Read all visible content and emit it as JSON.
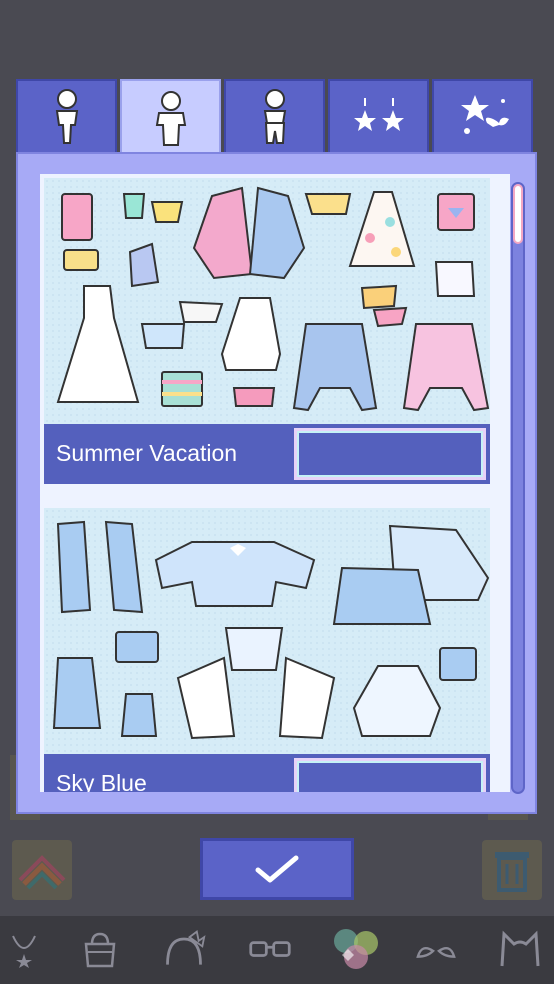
{
  "tabs": [
    {
      "name": "body-front-icon",
      "active": false
    },
    {
      "name": "top-clothes-icon",
      "active": true
    },
    {
      "name": "bottom-clothes-icon",
      "active": false
    },
    {
      "name": "earrings-icon",
      "active": false
    },
    {
      "name": "sparkle-decor-icon",
      "active": false
    }
  ],
  "sets": [
    {
      "title": "Summer Vacation"
    },
    {
      "title": "Sky Blue"
    }
  ],
  "bottom_nav": [
    "necklace-icon",
    "bag-icon",
    "headband-icon",
    "glasses-icon",
    "effect-icon",
    "ears-icon",
    "cat-icon"
  ],
  "colors": {
    "tab": "#5b63c8",
    "tab_active": "#c7ccff",
    "panel": "#a7aaf6",
    "bar": "#5460bd"
  }
}
